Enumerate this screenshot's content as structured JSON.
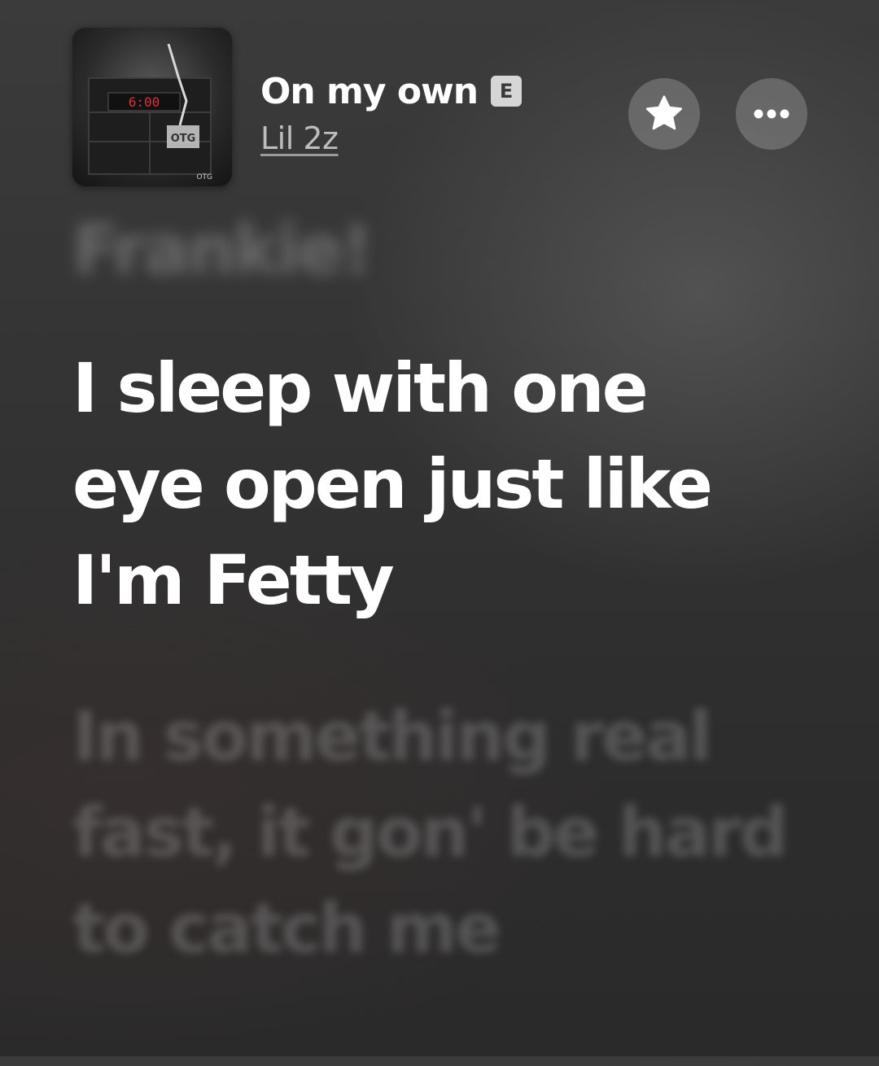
{
  "now_playing": {
    "title": "On my own",
    "explicit_badge": "E",
    "artist": "Lil 2z",
    "artwork_clock_text": "6:00",
    "actions": {
      "favorite_icon": "star-icon",
      "more_icon": "ellipsis-icon"
    }
  },
  "lyrics": {
    "previous": "Frankie!",
    "current": "I sleep with one eye open just like I'm Fetty",
    "next": "In something real fast, it gon' be hard to catch me",
    "after": ""
  },
  "colors": {
    "background": "#353535",
    "current_lyric": "#ffffff",
    "artist_text": "#bdbdbd",
    "button_fill": "#6e6e6e"
  }
}
